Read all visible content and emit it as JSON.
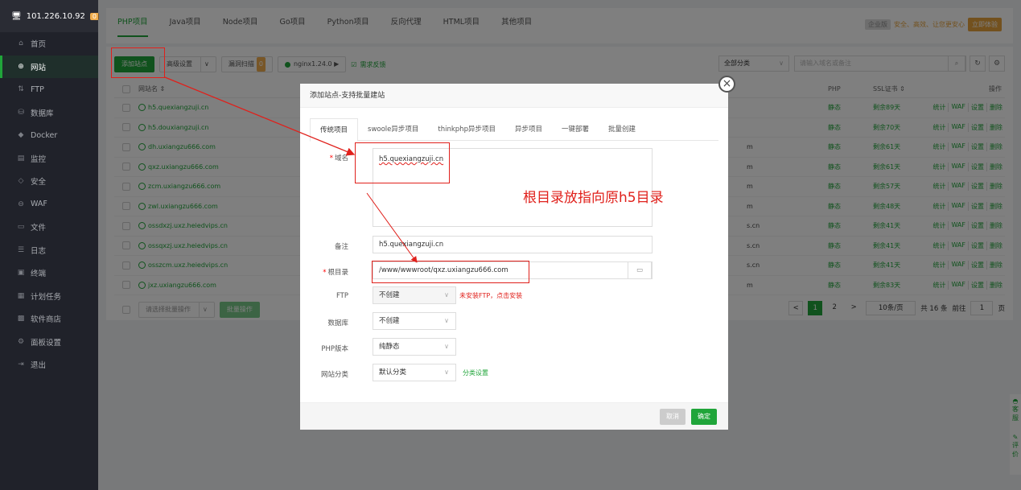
{
  "sidebar": {
    "ip": "101.226.10.92",
    "badge": "0",
    "items": [
      {
        "label": "首页",
        "icon": "home-icon"
      },
      {
        "label": "网站",
        "icon": "globe-icon",
        "active": true
      },
      {
        "label": "FTP",
        "icon": "ftp-icon"
      },
      {
        "label": "数据库",
        "icon": "database-icon"
      },
      {
        "label": "Docker",
        "icon": "docker-icon"
      },
      {
        "label": "监控",
        "icon": "monitor-icon"
      },
      {
        "label": "安全",
        "icon": "shield-icon"
      },
      {
        "label": "WAF",
        "icon": "waf-icon"
      },
      {
        "label": "文件",
        "icon": "folder-icon"
      },
      {
        "label": "日志",
        "icon": "log-icon"
      },
      {
        "label": "终端",
        "icon": "terminal-icon"
      },
      {
        "label": "计划任务",
        "icon": "calendar-icon"
      },
      {
        "label": "软件商店",
        "icon": "store-icon"
      },
      {
        "label": "面板设置",
        "icon": "gear-icon"
      },
      {
        "label": "退出",
        "icon": "logout-icon"
      }
    ]
  },
  "tabs": [
    "PHP项目",
    "Java项目",
    "Node项目",
    "Go项目",
    "Python项目",
    "反向代理",
    "HTML项目",
    "其他项目"
  ],
  "promo": {
    "badge": "企业版",
    "text": "安全、高效、让您更安心",
    "button": "立即体验"
  },
  "toolbar": {
    "add_site": "添加站点",
    "advanced": "高级设置",
    "scan": "漏洞扫描",
    "scan_count": "0",
    "nginx": "nginx1.24.0 ▶",
    "feedback": "需求反馈",
    "category": "全部分类",
    "search_placeholder": "请输入域名或备注"
  },
  "table": {
    "col_name": "网站名 ⇕",
    "col_php": "PHP",
    "col_ssl": "SSL证书 ⇕",
    "col_ops": "操作",
    "rows": [
      {
        "name": "h5.quexiangzuji.cn",
        "mid": "",
        "php": "静态",
        "ssl": "剩余89天"
      },
      {
        "name": "h5.douxiangzuji.cn",
        "mid": "",
        "php": "静态",
        "ssl": "剩余70天"
      },
      {
        "name": "dh.uxiangzu666.com",
        "mid": "m",
        "php": "静态",
        "ssl": "剩余61天"
      },
      {
        "name": "qxz.uxiangzu666.com",
        "mid": "m",
        "php": "静态",
        "ssl": "剩余61天"
      },
      {
        "name": "zcm.uxiangzu666.com",
        "mid": "m",
        "php": "静态",
        "ssl": "剩余57天"
      },
      {
        "name": "zwl.uxiangzu666.com",
        "mid": "m",
        "php": "静态",
        "ssl": "剩余48天"
      },
      {
        "name": "ossdxzj.uxz.heiedvips.cn",
        "mid": "s.cn",
        "php": "静态",
        "ssl": "剩余41天"
      },
      {
        "name": "ossqxzj.uxz.heiedvips.cn",
        "mid": "s.cn",
        "php": "静态",
        "ssl": "剩余41天"
      },
      {
        "name": "osszcm.uxz.heiedvips.cn",
        "mid": "s.cn",
        "php": "静态",
        "ssl": "剩余41天"
      },
      {
        "name": "jxz.uxiangzu666.com",
        "mid": "m",
        "php": "静态",
        "ssl": "剩余83天"
      }
    ],
    "ops": [
      "统计",
      "WAF",
      "设置",
      "删除"
    ]
  },
  "footer": {
    "batch_select": "请选择批量操作",
    "batch_btn": "批量操作",
    "page1": "1",
    "page2": "2",
    "per_page": "10条/页",
    "total": "共 16 条",
    "goto": "前往",
    "goto_val": "1",
    "page_unit": "页"
  },
  "side_float": [
    "客",
    "服",
    "评",
    "价"
  ],
  "modal": {
    "title": "添加站点-支持批量建站",
    "tabs": [
      "传统项目",
      "swoole异步项目",
      "thinkphp异步项目",
      "异步项目",
      "一键部署",
      "批量创建"
    ],
    "domain_label": "域名",
    "domain_value": "h5.quexiangzuji.cn",
    "remark_label": "备注",
    "remark_value": "h5.quexiangzuji.cn",
    "root_label": "根目录",
    "root_value": "/www/wwwroot/qxz.uxiangzu666.com",
    "ftp_label": "FTP",
    "ftp_value": "不创建",
    "ftp_hint": "未安装FTP，点击安装",
    "db_label": "数据库",
    "db_value": "不创建",
    "php_label": "PHP版本",
    "php_value": "纯静态",
    "cat_label": "网站分类",
    "cat_value": "默认分类",
    "cat_link": "分类设置",
    "cancel": "取消",
    "confirm": "确定"
  },
  "annotation": {
    "text": "根目录放指向原h5目录"
  },
  "colors": {
    "accent": "#20a53a",
    "annotation": "#e0201b",
    "sidebar": "#20222a"
  }
}
